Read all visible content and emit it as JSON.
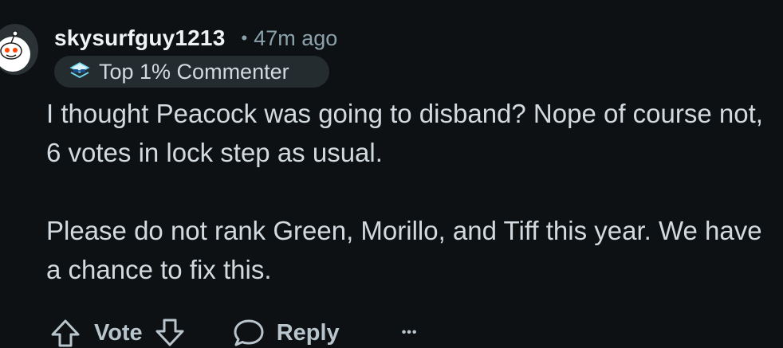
{
  "comment": {
    "username": "skysurfguy1213",
    "separator": "•",
    "timestamp": "47m ago",
    "flair": {
      "label": "Top 1% Commenter",
      "icon": "commenter-badge-icon"
    },
    "avatar_icon": "snoo-avatar-icon",
    "paragraphs": [
      "I thought Peacock was going to disband? Nope of course not, 6 votes in lock step as usual.",
      "Please do not rank Green, Morillo, and Tiff this year. We have a chance to fix this."
    ]
  },
  "actions": {
    "vote_label": "Vote",
    "reply_label": "Reply",
    "more_label": "•••",
    "upvote_icon": "upvote-arrow-icon",
    "downvote_icon": "downvote-arrow-icon",
    "reply_icon": "speech-bubble-icon"
  },
  "colors": {
    "background": "#0e1113",
    "text": "#d2dae0",
    "meta": "#8ba2ad",
    "badge_bg": "#242c30"
  }
}
